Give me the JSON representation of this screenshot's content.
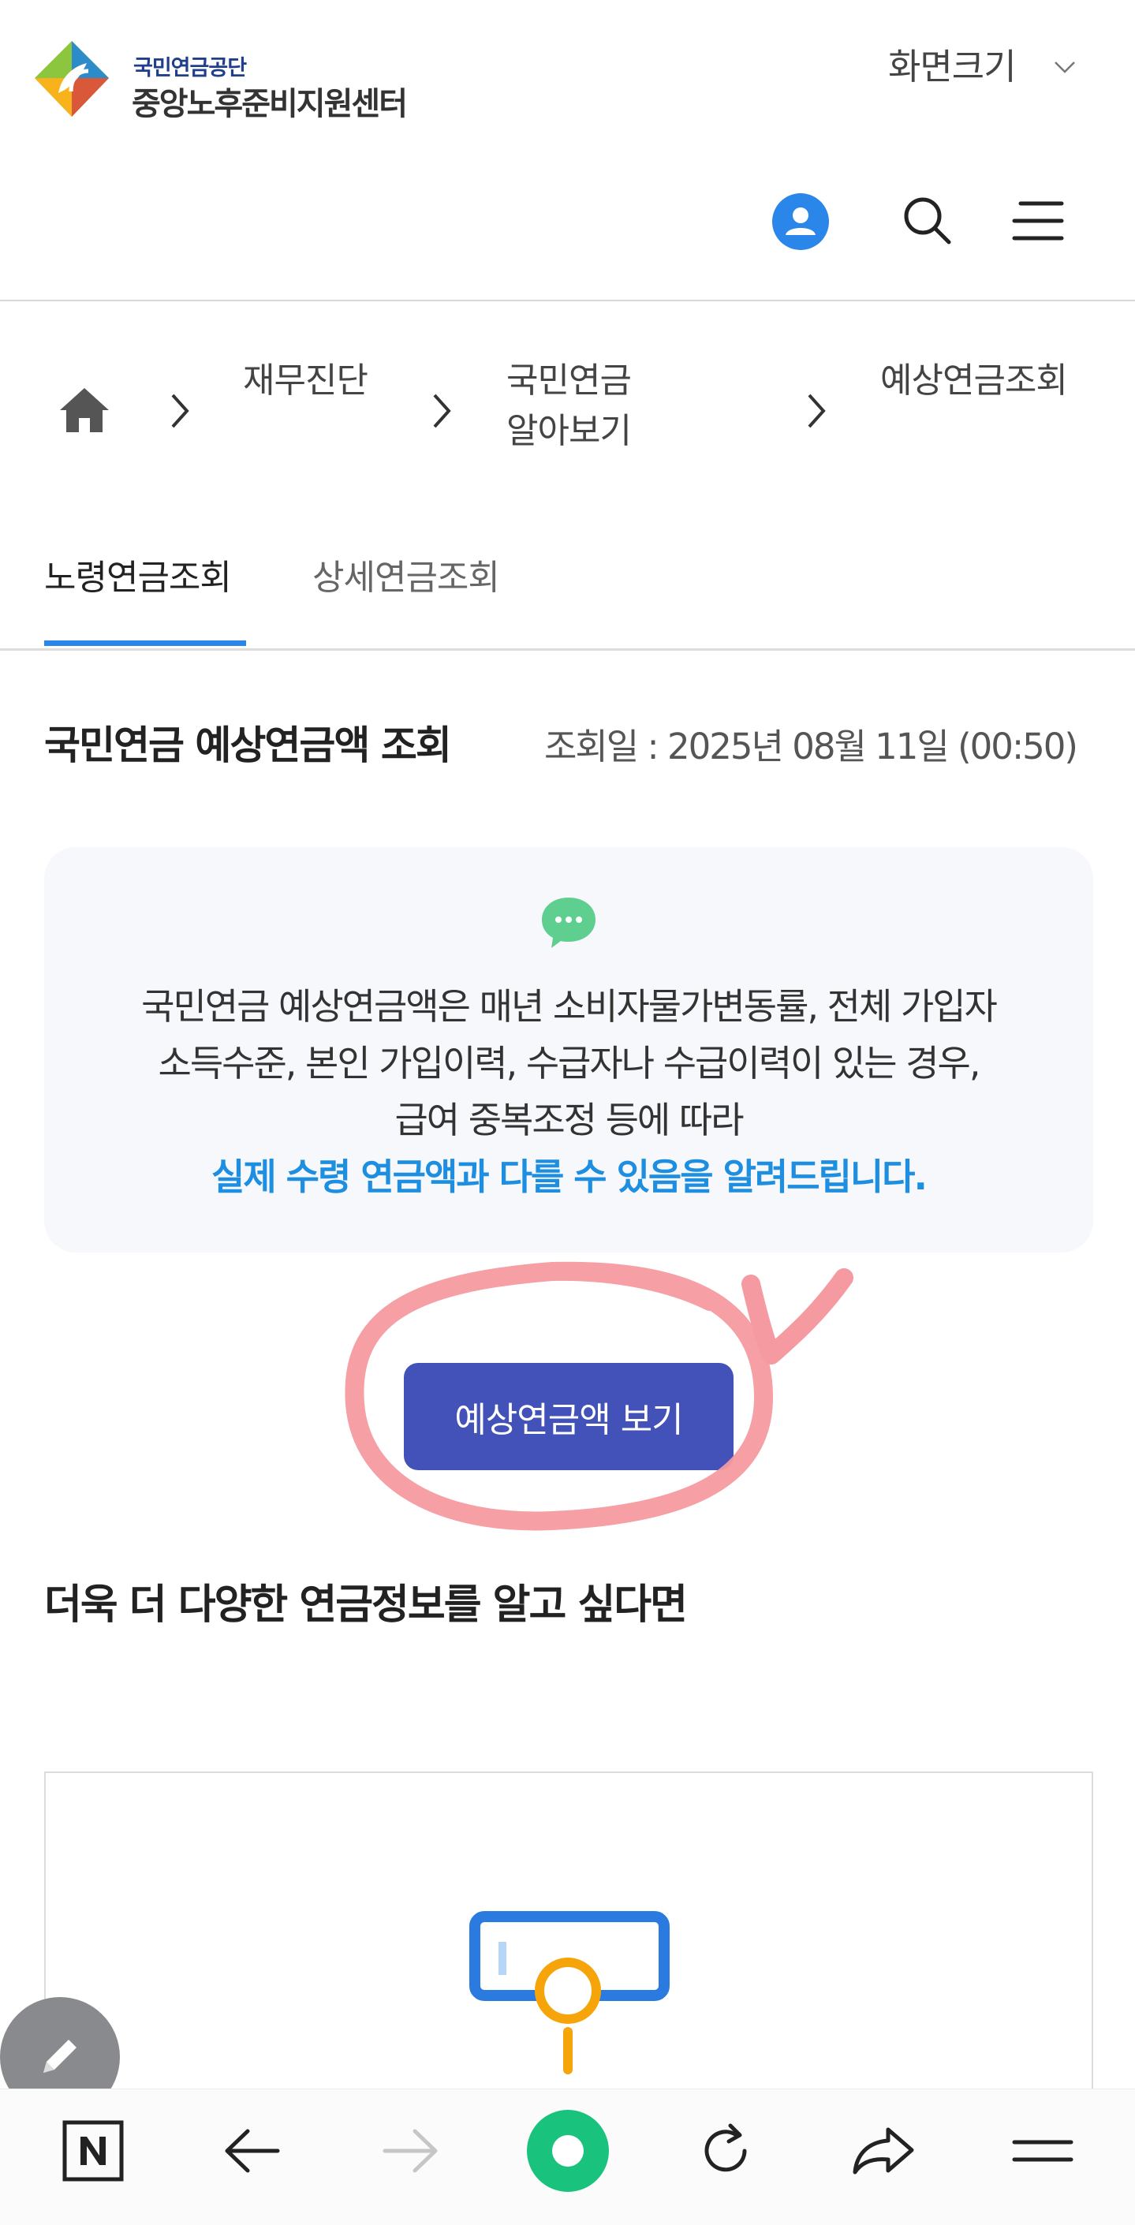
{
  "header": {
    "logo_org": "국민연금공단",
    "logo_center": "중앙노후준비지원센터",
    "screen_size_label": "화면크기"
  },
  "breadcrumb": {
    "items": [
      "재무진단",
      "국민연금",
      "알아보기",
      "예상연금조회"
    ]
  },
  "tabs": [
    {
      "label": "노령연금조회",
      "active": true
    },
    {
      "label": "상세연금조회",
      "active": false
    }
  ],
  "main": {
    "title": "국민연금 예상연금액 조회",
    "query_date": "조회일 : 2025년 08월 11일 (00:50)",
    "notice": {
      "line1": "국민연금 예상연금액은 매년 소비자물가변동률, 전체 가입자",
      "line2": "소득수준, 본인 가입이력, 수급자나 수급이력이 있는 경우,",
      "line3": "급여 중복조정 등에 따라",
      "highlight": "실제 수령 연금액과 다를 수 있음을 알려드립니다."
    },
    "button_label": "예상연금액 보기",
    "more_heading": "더욱 더 다양한 연금정보를 알고 싶다면"
  },
  "colors": {
    "accent_blue": "#2a86e8",
    "button": "#4352b9",
    "highlight_text": "#1e8fe0",
    "annotation_pink": "#f59aa0",
    "nav_green": "#19c37d"
  },
  "icons": {
    "header": [
      "user-icon",
      "search-icon",
      "menu-icon"
    ],
    "bottom_nav": [
      "naver-n-icon",
      "back-arrow-icon",
      "forward-arrow-icon",
      "green-dot-icon",
      "refresh-icon",
      "share-icon",
      "menu-icon"
    ]
  }
}
